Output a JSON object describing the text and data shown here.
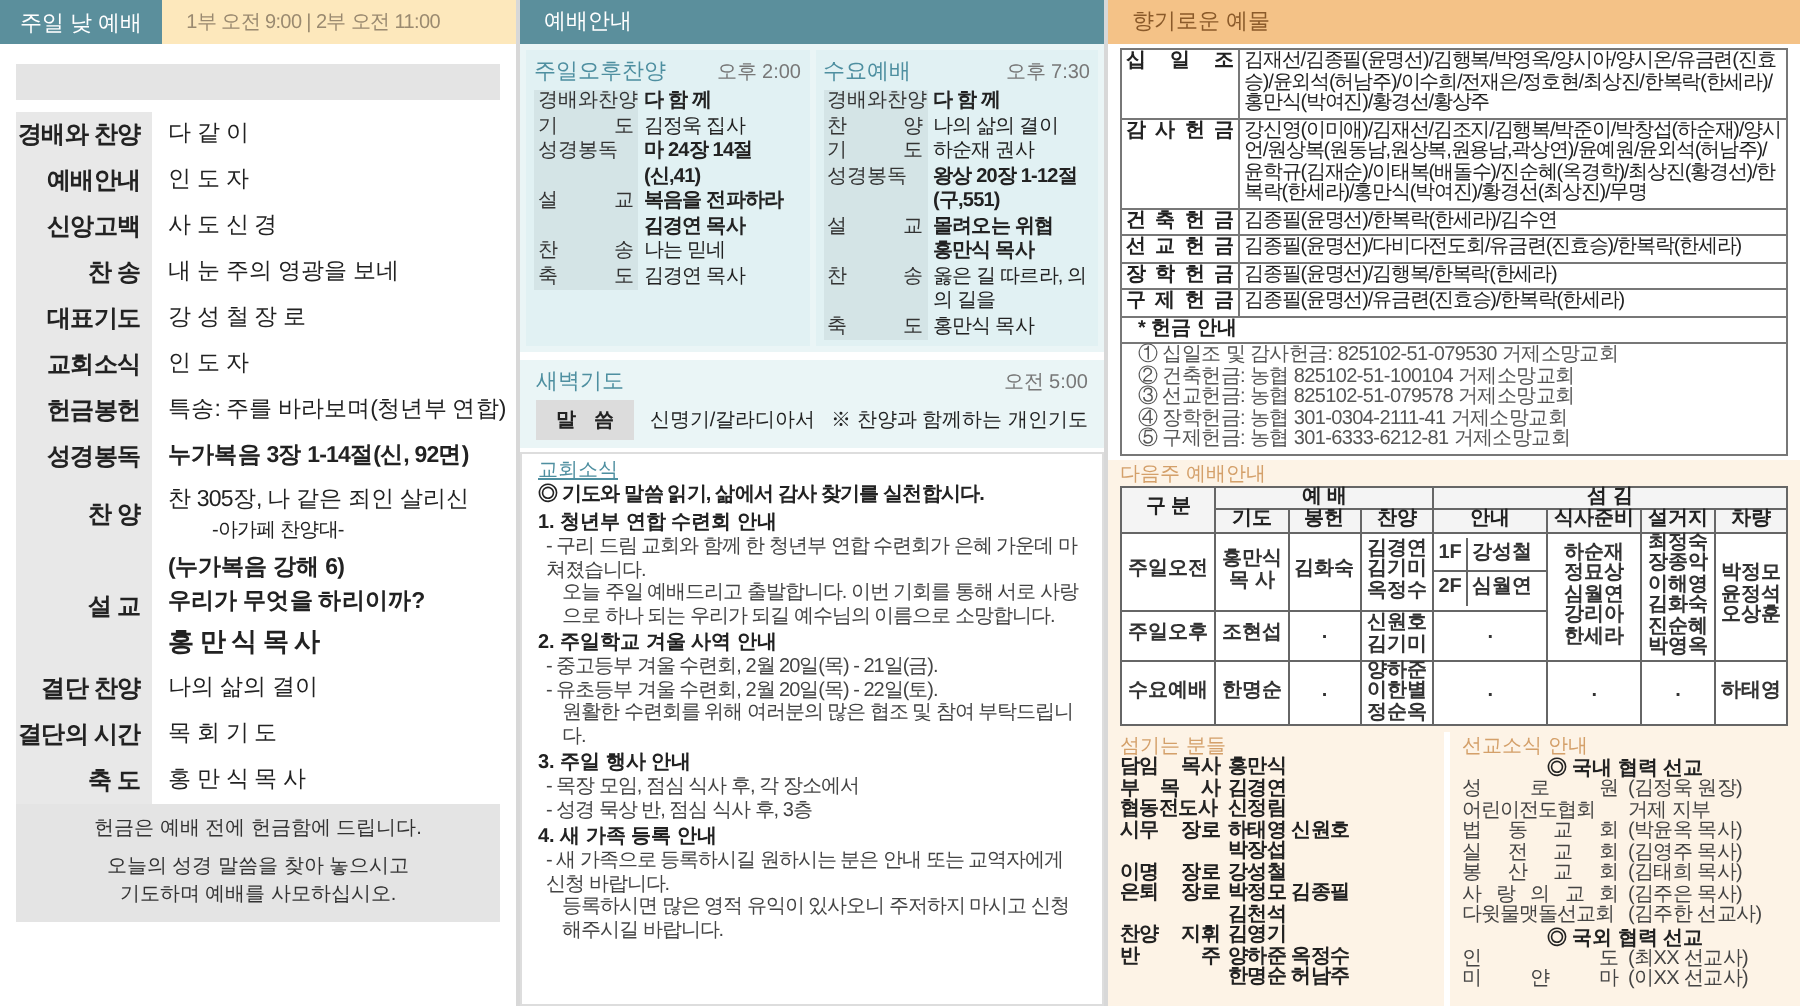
{
  "worship": {
    "title": "주일 낮 예배",
    "times": "1부 오전 9:00 | 2부 오전 11:00",
    "order": [
      {
        "label": "경배와 찬양",
        "lines": [
          {
            "text": "다 같 이",
            "kind": "plain"
          }
        ]
      },
      {
        "label": "예배안내",
        "lines": [
          {
            "text": "인 도 자",
            "kind": "plain"
          }
        ]
      },
      {
        "label": "신앙고백",
        "lines": [
          {
            "text": "사 도 신 경",
            "kind": "plain"
          }
        ]
      },
      {
        "label": "찬 송",
        "lines": [
          {
            "text": "내 눈 주의 영광을 보네",
            "kind": "plain"
          }
        ]
      },
      {
        "label": "대표기도",
        "lines": [
          {
            "text": "강 성 철 장 로",
            "kind": "plain"
          }
        ]
      },
      {
        "label": "교회소식",
        "lines": [
          {
            "text": "인 도 자",
            "kind": "plain"
          }
        ]
      },
      {
        "label": "헌금봉헌",
        "lines": [
          {
            "text": "특송:  주를 바라보며(청년부 연합)",
            "kind": "plain"
          }
        ]
      },
      {
        "label": "성경봉독",
        "lines": [
          {
            "text": "누가복음 3장 1-14절(신, 92면)",
            "kind": "bold"
          }
        ]
      },
      {
        "label": "찬 양",
        "lines": [
          {
            "text": "찬 305장, 나 같은 죄인 살리신",
            "kind": "plain"
          },
          {
            "text": "-아가페 찬양대-",
            "kind": "note"
          }
        ]
      },
      {
        "label": "설 교",
        "lines": [
          {
            "text": "(누가복음 강해 6)",
            "kind": "bold"
          },
          {
            "text": "우리가 무엇을 하리이까?",
            "kind": "bold"
          },
          {
            "text": "홍 만 식 목 사",
            "kind": "large"
          }
        ]
      },
      {
        "label": "결단 찬양",
        "lines": [
          {
            "text": "나의 삶의 결이",
            "kind": "plain"
          }
        ]
      },
      {
        "label": "결단의 시간",
        "lines": [
          {
            "text": "목 회 기 도",
            "kind": "plain"
          }
        ]
      },
      {
        "label": "축 도",
        "lines": [
          {
            "text": "홍 만 식 목 사",
            "kind": "plain"
          }
        ]
      }
    ],
    "notice": [
      "헌금은 예배 전에 헌금함에 드립니다.",
      "오늘의 성경 말씀을 찾아 놓으시고",
      "기도하며 예배를 사모하십시오."
    ]
  },
  "guide": {
    "title": "예배안내",
    "services": [
      {
        "title": "주일오후찬양",
        "time": "오후 2:00",
        "rows": [
          {
            "label": "경배와찬양",
            "value": "다 함 께",
            "bold": true
          },
          {
            "label": "기 도",
            "value": "김정욱 집사",
            "bold": false
          },
          {
            "label": "성경봉독",
            "value": "마 24장 14절(신,41)",
            "bold": true
          },
          {
            "label": "설 교",
            "value": "복음을 전파하라",
            "bold": true
          },
          {
            "value": "김경연 목사",
            "bold": true
          },
          {
            "label": "찬 송",
            "value": "나는 믿네",
            "bold": false
          },
          {
            "label": "축 도",
            "value": "김경연 목사",
            "bold": false
          }
        ]
      },
      {
        "title": "수요예배",
        "time": "오후 7:30",
        "rows": [
          {
            "label": "경배와찬양",
            "value": "다 함 께",
            "bold": true
          },
          {
            "label": "찬 양",
            "value": "나의 삶의 결이",
            "bold": false
          },
          {
            "label": "기 도",
            "value": "하순재 권사",
            "bold": false
          },
          {
            "label": "성경봉독",
            "value": "왕상 20장 1-12절(구,551)",
            "bold": true
          },
          {
            "label": "설 교",
            "value": "몰려오는 위협",
            "bold": true
          },
          {
            "value": "홍만식 목사",
            "bold": true
          },
          {
            "label": "찬 송",
            "value": "옳은 길 따르라, 의의 길을",
            "bold": false
          },
          {
            "label": "축 도",
            "value": "홍만식 목사",
            "bold": false
          }
        ]
      }
    ],
    "dawn": {
      "title": "새벽기도",
      "time": "오전 5:00",
      "label": "말 씀",
      "value": "신명기/갈라디아서",
      "note": "※ 찬양과 함께하는 개인기도"
    },
    "news": {
      "title": "교회소식",
      "headline": "◎ 기도와 말씀 읽기, 삶에서 감사 찾기를 실천합시다.",
      "items": [
        {
          "heading": "1. 청년부 연합 수련회 안내",
          "lines": [
            {
              "text": "- 구리 드림 교회와 함께 한 청년부 연합 수련회가 은혜 가운데 마쳐졌습니다.",
              "kind": "dash"
            },
            {
              "text": "오늘 주일 예배드리고 출발합니다. 이번 기회를 통해 서로 사랑으로 하나 되는 우리가 되길 예수님의 이름으로 소망합니다.",
              "kind": "cont"
            }
          ]
        },
        {
          "heading": "2. 주일학교 겨울 사역 안내",
          "lines": [
            {
              "text": "- 중고등부 겨울 수련회, 2월 20일(목) - 21일(금).",
              "kind": "dash"
            },
            {
              "text": "- 유초등부 겨울 수련회, 2월 20일(목) - 22일(토).",
              "kind": "dash"
            },
            {
              "text": "원활한 수련회를 위해 여러분의 많은 협조 및 참여 부탁드립니다.",
              "kind": "cont"
            }
          ]
        },
        {
          "heading": "3. 주일 행사 안내",
          "lines": [
            {
              "text": "- 목장 모임, 점심 식사 후, 각 장소에서",
              "kind": "dash"
            },
            {
              "text": "- 성경 묵상 반, 점심 식사 후, 3층",
              "kind": "dash"
            }
          ]
        },
        {
          "heading": "4. 새 가족 등록 안내",
          "lines": [
            {
              "text": "- 새 가족으로 등록하시길 원하시는 분은 안내 또는 교역자에게 신청 바랍니다.",
              "kind": "dash"
            },
            {
              "text": "등록하시면 많은 영적 유익이 있사오니 주저하지 마시고 신청해주시길 바랍니다.",
              "kind": "cont"
            }
          ]
        }
      ]
    }
  },
  "offerings": {
    "title": "향기로운 예물",
    "rows": [
      {
        "label": "십 일 조",
        "names": "김재선/김종필(윤명선)/김행복/박영옥/양시아/양시온/유금련(진효승)/윤외석(허남주)/이수희/전재은/정호현/최상진/한복락(한세라)/홍만식(박여진)/황경선/황상주"
      },
      {
        "label": "감 사 헌 금",
        "names": "강신영(이미애)/김재선/김조지/김행복/박준이/박창섭(하순재)/양시언/원상복(원동남,원상복,원용남,곽상연)/윤예원/윤외석(허남주)/윤학규(김재순)/이태복(배돌수)/진순혜(옥경학)/최상진(황경선)/한복락(한세라)/홍만식(박여진)/황경선(최상진)/무명"
      },
      {
        "label": "건 축 헌 금",
        "names": "김종필(윤명선)/한복락(한세라)/김수연"
      },
      {
        "label": "선 교 헌 금",
        "names": "김종필(윤명선)/다비다전도회/유금련(진효승)/한복락(한세라)"
      },
      {
        "label": "장 학 헌 금",
        "names": "김종필(윤명선)/김행복/한복락(한세라)"
      },
      {
        "label": "구 제 헌 금",
        "names": "김종필(윤명선)/유금련(진효승)/한복락(한세라)"
      }
    ],
    "guide_title": "* 헌금 안내",
    "accounts": [
      "① 십일조 및 감사헌금: 825102-51-079530 거제소망교회",
      "② 건축헌금: 농협 825102-51-100104 거제소망교회",
      "③ 선교헌금: 농협 825102-51-079578 거제소망교회",
      "④ 장학헌금: 농협 301-0304-2111-41 거제소망교회",
      "⑤ 구제헌금: 농협 301-6333-6212-81 거제소망교회"
    ]
  },
  "next_week": {
    "title": "다음주 예배안내",
    "corner": "구 분",
    "groups": [
      {
        "label": "예 배",
        "columns": [
          "기도",
          "봉헌",
          "찬양"
        ]
      },
      {
        "label": "섬 김",
        "columns": [
          "안내",
          "식사준비",
          "설거지",
          "차량"
        ]
      }
    ],
    "rows": [
      {
        "label": "주일오전",
        "cells": [
          {
            "lines": [
              "홍만식",
              "목 사"
            ]
          },
          {
            "lines": [
              "김화숙"
            ]
          },
          {
            "lines": [
              "김경연",
              "김기미",
              "옥정수"
            ]
          },
          {
            "kind": "floors",
            "floors": [
              {
                "floor": "1F",
                "name": "강성철"
              },
              {
                "floor": "2F",
                "name": "심월연"
              }
            ]
          },
          {
            "lines": [
              "하순재",
              "정묘상",
              "심월연",
              "강리아",
              "한세라"
            ],
            "rowspan": 2
          },
          {
            "lines": [
              "최정숙",
              "장종악",
              "이해영",
              "김화숙",
              "진순혜",
              "박영옥"
            ],
            "rowspan": 2
          },
          {
            "lines": [
              "박정모",
              "윤정석",
              "오상훈"
            ],
            "rowspan": 2
          }
        ]
      },
      {
        "label": "주일오후",
        "cells": [
          {
            "lines": [
              "조현섭"
            ]
          },
          {
            "lines": [
              "."
            ]
          },
          {
            "lines": [
              "신원호",
              "김기미"
            ]
          },
          {
            "lines": [
              "."
            ]
          }
        ]
      },
      {
        "label": "수요예배",
        "cells": [
          {
            "lines": [
              "한명순"
            ]
          },
          {
            "lines": [
              "."
            ]
          },
          {
            "lines": [
              "양하준",
              "이한별",
              "정순옥"
            ]
          },
          {
            "lines": [
              "."
            ]
          },
          {
            "lines": [
              "."
            ]
          },
          {
            "lines": [
              "."
            ]
          },
          {
            "lines": [
              "하태영"
            ]
          }
        ]
      }
    ]
  },
  "servants": {
    "title": "섬기는 분들",
    "rows": [
      {
        "role": "담임 목사",
        "names": [
          "홍만식"
        ]
      },
      {
        "role": "부 목 사",
        "names": [
          "김경연"
        ]
      },
      {
        "role": "협동전도사",
        "names": [
          "신정림"
        ]
      },
      {
        "role": "시무 장로",
        "names": [
          "하태영 신원호",
          "박장섭"
        ]
      },
      {
        "role": "이명 장로",
        "names": [
          "강성철"
        ]
      },
      {
        "role": "은퇴 장로",
        "names": [
          "박정모 김종필",
          "김천석"
        ]
      },
      {
        "role": "찬양 지휘",
        "names": [
          "김영기"
        ]
      },
      {
        "role": "반 주",
        "names": [
          "양하준 옥정수",
          "한명순 허남주"
        ]
      }
    ]
  },
  "mission": {
    "title": "선교소식 안내",
    "groups": [
      {
        "heading": "◎ 국내 협력 선교",
        "items": [
          {
            "place": "성 로 원",
            "person": "(김정욱 원장)"
          },
          {
            "place": "어린이전도협회",
            "person": "거제 지부"
          },
          {
            "place": "법 동 교 회",
            "person": "(박윤옥 목사)"
          },
          {
            "place": "실 전 교 회",
            "person": "(김영주 목사)"
          },
          {
            "place": "봉 산 교 회",
            "person": "(김태희 목사)"
          },
          {
            "place": "사 랑 의 교 회",
            "person": "(김주은 목사)"
          },
          {
            "place": "다윗물맷돌선교회",
            "person": "(김주한 선교사)"
          }
        ]
      },
      {
        "heading": "◎ 국외 협력 선교",
        "items": [
          {
            "place": "인 도",
            "person": "(최XX 선교사)"
          },
          {
            "place": "미 얀 마",
            "person": "(이XX 선교사)"
          }
        ]
      }
    ]
  }
}
